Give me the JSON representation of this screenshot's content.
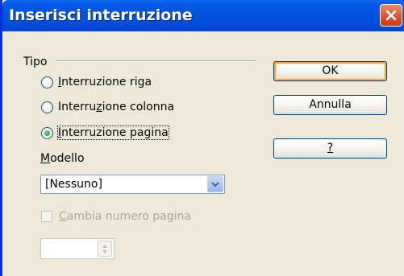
{
  "window": {
    "title": "Inserisci interruzione"
  },
  "group": {
    "label": "Tipo"
  },
  "radios": [
    {
      "prefix": "",
      "mnemonic": "I",
      "suffix": "nterruzione riga",
      "checked": false
    },
    {
      "prefix": "Interru",
      "mnemonic": "z",
      "suffix": "ione colonna",
      "checked": false
    },
    {
      "prefix": "",
      "mnemonic": "I",
      "suffix": "nterruzione pagina",
      "checked": true
    }
  ],
  "modello": {
    "label_mnemonic": "M",
    "label_rest": "odello",
    "value": "[Nessuno]"
  },
  "change_page_number": {
    "label_mnemonic": "C",
    "label_rest": "ambia numero pagina",
    "checked": false,
    "enabled": false
  },
  "page_number_field": {
    "value": ""
  },
  "buttons": {
    "ok": "OK",
    "cancel": "Annulla",
    "help": "?"
  },
  "icons": {
    "close": "close-icon",
    "dropdown": "chevron-down-icon",
    "spin": "spin-arrows-icon"
  },
  "colors": {
    "titlebar": "#0454e0",
    "close_button": "#d9512a",
    "background": "#ece9d8",
    "radio_checked": "#218a21"
  }
}
